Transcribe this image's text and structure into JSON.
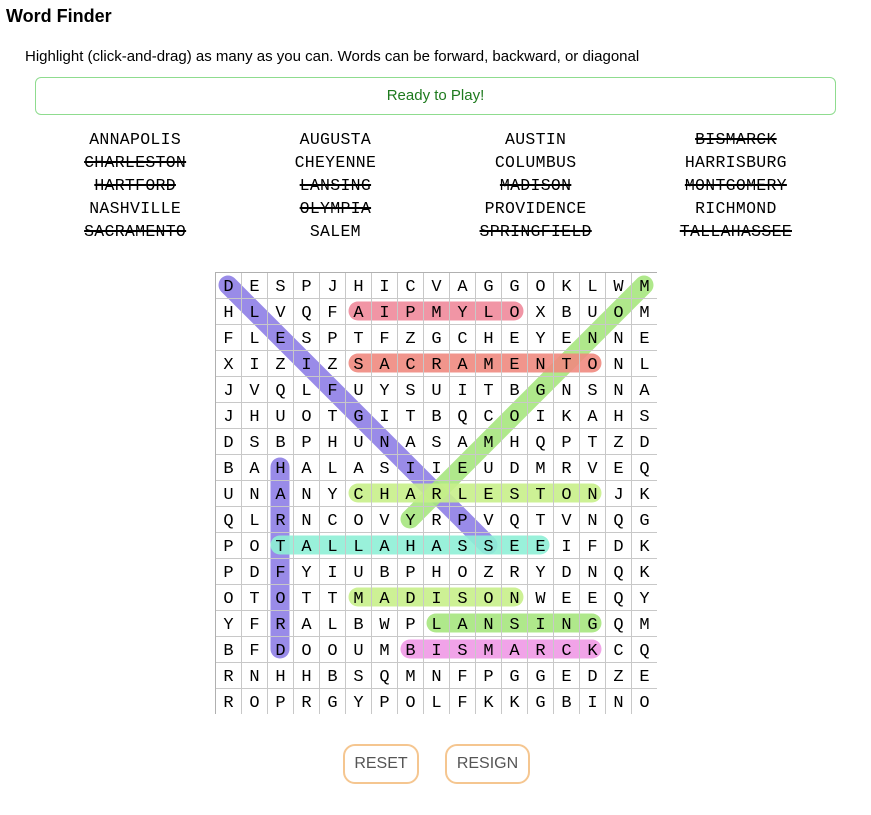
{
  "app": {
    "title": "Word Finder",
    "instructions": "Highlight (click-and-drag) as many as you can. Words can be forward, backward, or diagonal",
    "status": "Ready to Play!"
  },
  "words": [
    {
      "text": "ANNAPOLIS",
      "found": false
    },
    {
      "text": "AUGUSTA",
      "found": false
    },
    {
      "text": "AUSTIN",
      "found": false
    },
    {
      "text": "BISMARCK",
      "found": true
    },
    {
      "text": "CHARLESTON",
      "found": true
    },
    {
      "text": "CHEYENNE",
      "found": false
    },
    {
      "text": "COLUMBUS",
      "found": false
    },
    {
      "text": "HARRISBURG",
      "found": false
    },
    {
      "text": "HARTFORD",
      "found": true
    },
    {
      "text": "LANSING",
      "found": true
    },
    {
      "text": "MADISON",
      "found": true
    },
    {
      "text": "MONTGOMERY",
      "found": true
    },
    {
      "text": "NASHVILLE",
      "found": false
    },
    {
      "text": "OLYMPIA",
      "found": true
    },
    {
      "text": "PROVIDENCE",
      "found": false
    },
    {
      "text": "RICHMOND",
      "found": false
    },
    {
      "text": "SACRAMENTO",
      "found": true
    },
    {
      "text": "SALEM",
      "found": false
    },
    {
      "text": "SPRINGFIELD",
      "found": true
    },
    {
      "text": "TALLAHASSEE",
      "found": true
    }
  ],
  "grid": [
    "DESPJHICVAGGOKLWM",
    "HLVQFAIPMYLOXBUOM",
    "FLESPTFZGCHEYENNE",
    "XIZIZSACRAMENTONL",
    "JVQLFUYSUITBGNSNA",
    "JHUOTGITBQCOIKAHS",
    "DSBPHUNASAMHQPTZD",
    "BAHALASIIEUDMRVEQ",
    "UNANYCHARLESTONJK",
    "QLRNCOVYRPVQTVNQG",
    "POTALLAHASSEEIFDK",
    "PDFYIUBPHOZRYDNQK",
    "OTOTTMADISONWEEQY",
    "YFRALBWPLANSINGQM",
    "BFDOOUMBISMARCKCQ",
    "RNHHBSQMNFPGGEDZE",
    "ROPRGYPOLFKKGBINO"
  ],
  "highlights": [
    {
      "word": "SPRINGFIELD",
      "color": "#8f7fe6",
      "start": [
        0,
        0
      ],
      "end": [
        10,
        10
      ]
    },
    {
      "word": "MONTGOMERY",
      "color": "#a7e67f",
      "start": [
        0,
        16
      ],
      "end": [
        9,
        7
      ]
    },
    {
      "word": "OLYMPIA",
      "color": "#f08a9c",
      "start": [
        1,
        11
      ],
      "end": [
        1,
        5
      ]
    },
    {
      "word": "SACRAMENTO",
      "color": "#f08a80",
      "start": [
        3,
        5
      ],
      "end": [
        3,
        14
      ]
    },
    {
      "word": "HARTFORD",
      "color": "#8f7fe6",
      "start": [
        7,
        2
      ],
      "end": [
        14,
        2
      ]
    },
    {
      "word": "CHARLESTON",
      "color": "#c8f08a",
      "start": [
        8,
        5
      ],
      "end": [
        8,
        14
      ]
    },
    {
      "word": "TALLAHASSEE",
      "color": "#8ff0d6",
      "start": [
        10,
        2
      ],
      "end": [
        10,
        12
      ]
    },
    {
      "word": "MADISON",
      "color": "#c8f08a",
      "start": [
        12,
        5
      ],
      "end": [
        12,
        11
      ]
    },
    {
      "word": "LANSING",
      "color": "#a7e67f",
      "start": [
        13,
        8
      ],
      "end": [
        13,
        14
      ]
    },
    {
      "word": "BISMARCK",
      "color": "#f09ae6",
      "start": [
        14,
        7
      ],
      "end": [
        14,
        14
      ]
    }
  ],
  "buttons": {
    "reset": "RESET",
    "resign": "RESIGN"
  }
}
